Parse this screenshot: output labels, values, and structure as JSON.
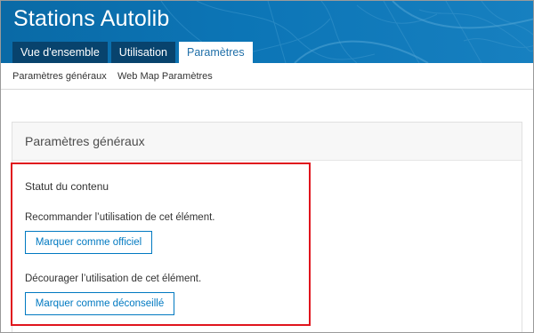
{
  "app": {
    "title": "Stations Autolib"
  },
  "tabs": [
    {
      "label": "Vue d'ensemble",
      "active": false
    },
    {
      "label": "Utilisation",
      "active": false
    },
    {
      "label": "Paramètres",
      "active": true
    }
  ],
  "subnav": {
    "items": [
      {
        "label": "Paramètres généraux"
      },
      {
        "label": "Web Map Paramètres"
      }
    ]
  },
  "panel": {
    "title": "Paramètres généraux",
    "section_title": "Statut du contenu",
    "recommend_label": "Recommander l’utilisation de cet élément.",
    "official_button": "Marquer comme officiel",
    "discourage_label": "Décourager l’utilisation de cet élément.",
    "deprecated_button": "Marquer comme déconseillé"
  },
  "colors": {
    "banner": "#0c75b6",
    "tab_inactive": "#08436d",
    "accent": "#0079c1",
    "highlight": "#e0151d"
  }
}
